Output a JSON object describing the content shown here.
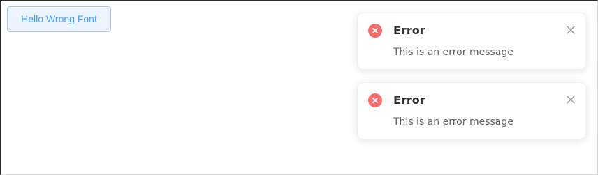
{
  "button": {
    "label": "Hello Wrong Font"
  },
  "notifications": [
    {
      "type": "error",
      "icon": "error-icon",
      "title": "Error",
      "message": "This is an error message"
    },
    {
      "type": "error",
      "icon": "error-icon",
      "title": "Error",
      "message": "This is an error message"
    }
  ],
  "colors": {
    "error": "#f56c6c",
    "primary": "#409eff",
    "button_bg": "#ecf5ff",
    "title": "#303133",
    "message": "#606266"
  }
}
